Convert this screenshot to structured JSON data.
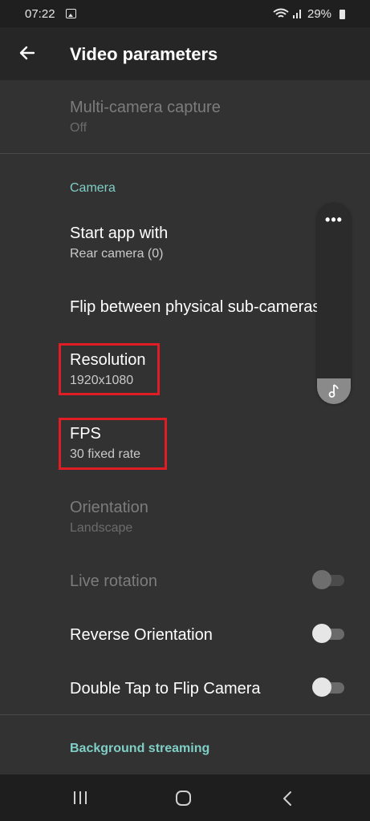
{
  "status_bar": {
    "time": "07:22",
    "battery": "29%"
  },
  "app_bar": {
    "title": "Video parameters",
    "back_icon": "arrow-left-icon"
  },
  "preferences": {
    "multi_camera": {
      "title": "Multi-camera capture",
      "summary": "Off",
      "enabled": false
    },
    "camera_section": "Camera",
    "start_app_with": {
      "title": "Start app with",
      "summary": "Rear camera (0)"
    },
    "flip_subcameras": {
      "title": "Flip between physical sub-cameras"
    },
    "resolution": {
      "title": "Resolution",
      "summary": "1920x1080"
    },
    "fps": {
      "title": "FPS",
      "summary": "30 fixed rate"
    },
    "orientation": {
      "title": "Orientation",
      "summary": "Landscape",
      "enabled": false
    },
    "live_rotation": {
      "title": "Live rotation",
      "enabled": false,
      "checked": false
    },
    "reverse_orientation": {
      "title": "Reverse Orientation",
      "checked": false
    },
    "double_tap_flip": {
      "title": "Double Tap to Flip Camera",
      "checked": false
    },
    "background_section": "Background streaming"
  },
  "floating_panel": {
    "more_icon": "more-dots-icon",
    "music_icon": "music-note-icon",
    "more_label": "•••"
  },
  "nav_bar": {
    "recents": "recents-icon",
    "home": "home-icon",
    "back": "back-icon"
  },
  "colors": {
    "accent": "#7fcfc6",
    "highlight": "#e01c24",
    "background": "#323232"
  }
}
